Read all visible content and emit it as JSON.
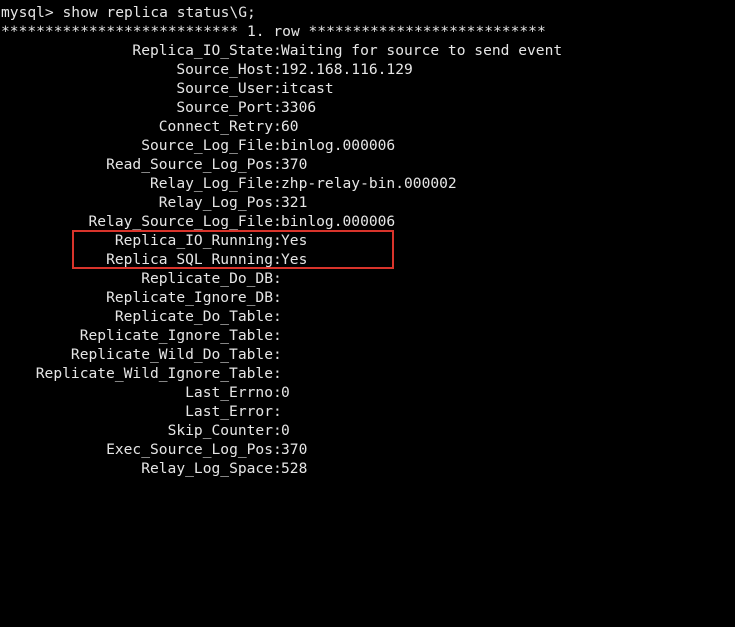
{
  "prompt": "mysql> show replica status\\G;",
  "separator": "*************************** 1. row ***************************",
  "fields": [
    {
      "key": "Replica_IO_State",
      "value": "Waiting for source to send event"
    },
    {
      "key": "Source_Host",
      "value": "192.168.116.129"
    },
    {
      "key": "Source_User",
      "value": "itcast"
    },
    {
      "key": "Source_Port",
      "value": "3306"
    },
    {
      "key": "Connect_Retry",
      "value": "60"
    },
    {
      "key": "Source_Log_File",
      "value": "binlog.000006"
    },
    {
      "key": "Read_Source_Log_Pos",
      "value": "370"
    },
    {
      "key": "Relay_Log_File",
      "value": "zhp-relay-bin.000002"
    },
    {
      "key": "Relay_Log_Pos",
      "value": "321"
    },
    {
      "key": "Relay_Source_Log_File",
      "value": "binlog.000006"
    },
    {
      "key": "Replica_IO_Running",
      "value": "Yes"
    },
    {
      "key": "Replica_SQL_Running",
      "value": "Yes"
    },
    {
      "key": "Replicate_Do_DB",
      "value": ""
    },
    {
      "key": "Replicate_Ignore_DB",
      "value": ""
    },
    {
      "key": "Replicate_Do_Table",
      "value": ""
    },
    {
      "key": "Replicate_Ignore_Table",
      "value": ""
    },
    {
      "key": "Replicate_Wild_Do_Table",
      "value": ""
    },
    {
      "key": "Replicate_Wild_Ignore_Table",
      "value": ""
    },
    {
      "key": "Last_Errno",
      "value": "0"
    },
    {
      "key": "Last_Error",
      "value": ""
    },
    {
      "key": "Skip_Counter",
      "value": "0"
    },
    {
      "key": "Exec_Source_Log_Pos",
      "value": "370"
    },
    {
      "key": "Relay_Log_Space",
      "value": "528"
    }
  ],
  "colon": ":",
  "colors": {
    "background": "#000000",
    "text": "#e6e6e6",
    "highlight_border": "#d9342b"
  }
}
